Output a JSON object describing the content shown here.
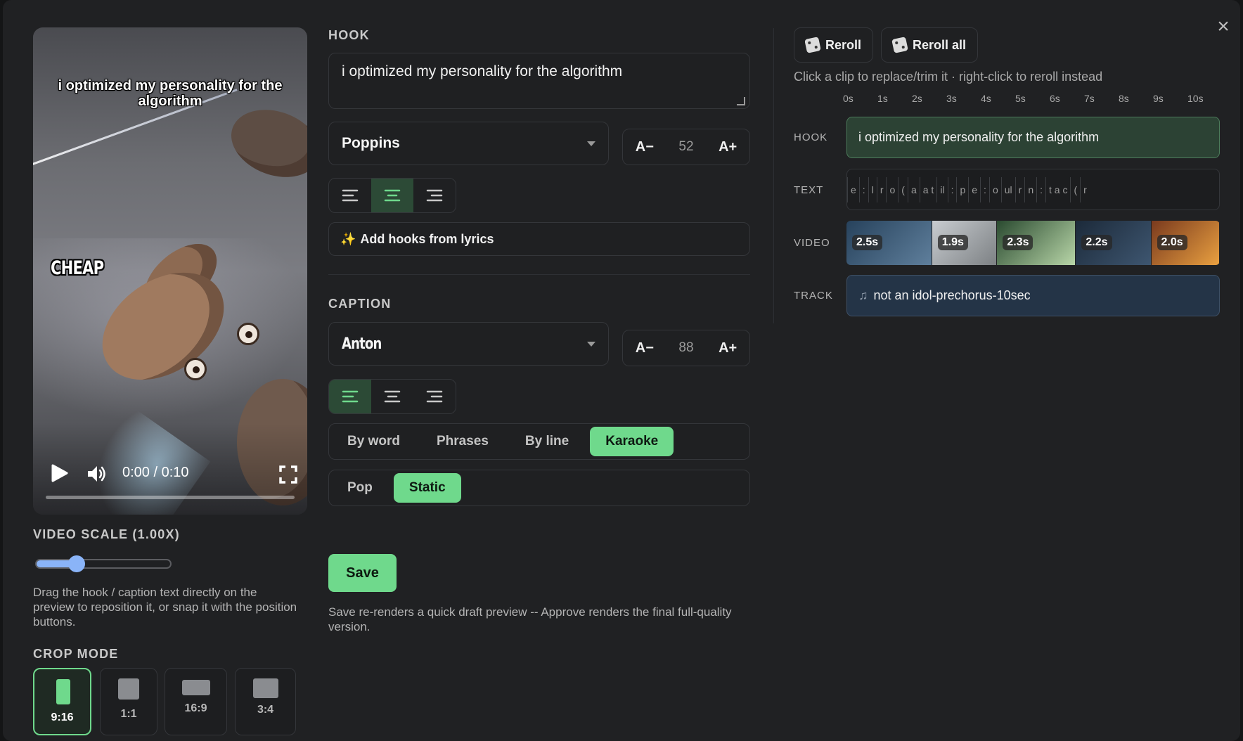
{
  "preview": {
    "hook_text": "i optimized my personality for the algorithm",
    "caption_text": "CHEAP",
    "time": "0:00 / 0:10",
    "progress": 0.0
  },
  "video_scale": {
    "label": "VIDEO SCALE (1.00X)",
    "value": 1.0,
    "fraction": 0.3
  },
  "help_text": "Drag the hook / caption text directly on the preview to reposition it, or snap it with the position buttons.",
  "crop": {
    "label": "CROP MODE",
    "options": [
      "9:16",
      "1:1",
      "16:9",
      "3:4"
    ],
    "selected": "9:16"
  },
  "hook": {
    "label": "HOOK",
    "text": "i optimized my personality for the algorithm",
    "font": "Poppins",
    "size_dec": "A−",
    "size": "52",
    "size_inc": "A+",
    "align": "center",
    "lyrics_button": "Add hooks from lyrics"
  },
  "caption": {
    "label": "CAPTION",
    "font": "Anton",
    "size_dec": "A−",
    "size": "88",
    "size_inc": "A+",
    "align": "left",
    "modes": [
      "By word",
      "Phrases",
      "By line",
      "Karaoke"
    ],
    "mode_selected": "Karaoke",
    "animations": [
      "Pop",
      "Static"
    ],
    "animation_selected": "Static"
  },
  "save": {
    "label": "Save",
    "note": "Save re-renders a quick draft preview -- Approve renders the final full-quality version."
  },
  "timeline": {
    "reroll_label": "Reroll",
    "reroll_all_label": "Reroll all",
    "hint": "Click a clip to replace/trim it · right-click to reroll instead",
    "ticks": [
      "0s",
      "1s",
      "2s",
      "3s",
      "4s",
      "5s",
      "6s",
      "7s",
      "8s",
      "9s",
      "10s"
    ],
    "rows": {
      "hook": "HOOK",
      "text": "TEXT",
      "video": "VIDEO",
      "track": "TRACK"
    },
    "hook_clip": "i optimized my personality for the algorithm",
    "text_clips": [
      "e",
      ":",
      "l",
      "r",
      "o",
      "(",
      "a",
      "a t",
      "il",
      ":",
      "p",
      "e",
      ":",
      "o",
      "ul",
      "r",
      "n",
      ":",
      "t a c",
      "(",
      "r"
    ],
    "video_clips": [
      {
        "duration": "2.5s",
        "color_a": "#27425c",
        "color_b": "#5f7f9c"
      },
      {
        "duration": "1.9s",
        "color_a": "#c8ccd0",
        "color_b": "#7d8184"
      },
      {
        "duration": "2.3s",
        "color_a": "#2a4a30",
        "color_b": "#b8d6a8"
      },
      {
        "duration": "2.2s",
        "color_a": "#1c2a3a",
        "color_b": "#3e5670"
      },
      {
        "duration": "2.0s",
        "color_a": "#7a3a1e",
        "color_b": "#e9a040"
      }
    ],
    "track_name": "not an idol-prechorus-10sec"
  },
  "colors": {
    "accent": "#6fd98c",
    "slider": "#8ab4f8",
    "background": "#202123"
  }
}
